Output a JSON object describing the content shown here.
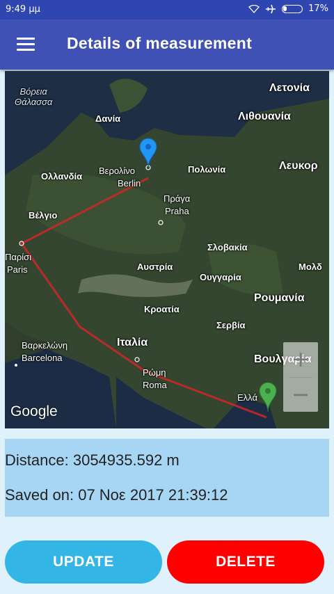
{
  "status_bar": {
    "time": "9:49 μμ",
    "battery": "17%"
  },
  "app_bar": {
    "title": "Details of measurement"
  },
  "map": {
    "labels": {
      "north_sea": "Βόρεια\nΘάλασσα",
      "latvia": "Λετονία",
      "denmark": "Δανία",
      "lithuania": "Λιθουανία",
      "netherlands": "Ολλανδία",
      "berlin_gr": "Βερολίνο",
      "berlin": "Berlin",
      "poland": "Πολωνία",
      "belarus": "Λευκορ",
      "prague_gr": "Πράγα",
      "prague": "Praha",
      "belgium": "Βέλγιο",
      "paris_gr": "Παρίσι",
      "paris": "Paris",
      "slovakia": "Σλοβακία",
      "moldova": "Μολδ",
      "austria": "Αυστρία",
      "hungary": "Ουγγαρία",
      "romania": "Ρουμανία",
      "croatia": "Κροατία",
      "serbia": "Σερβία",
      "barcelona_gr": "Βαρκελώνη",
      "barcelona": "Barcelona",
      "italy": "Ιταλία",
      "rome_gr": "Ρώμη",
      "rome": "Roma",
      "bulgaria": "Βουλγαρία",
      "greece": "Ελλά"
    },
    "attribution": "Google",
    "zoom_in": "+",
    "zoom_out": "−"
  },
  "measurement": {
    "distance_label": "Distance:",
    "distance_value": "3054935.592 m",
    "saved_label": "Saved on:",
    "saved_value": "07 Νοε 2017 21:39:12"
  },
  "actions": {
    "update": "UPDATE",
    "delete": "DELETE"
  },
  "colors": {
    "primary": "#3f51b5",
    "update": "#33b5e5",
    "delete": "#ff0000",
    "route": "#c62828"
  }
}
